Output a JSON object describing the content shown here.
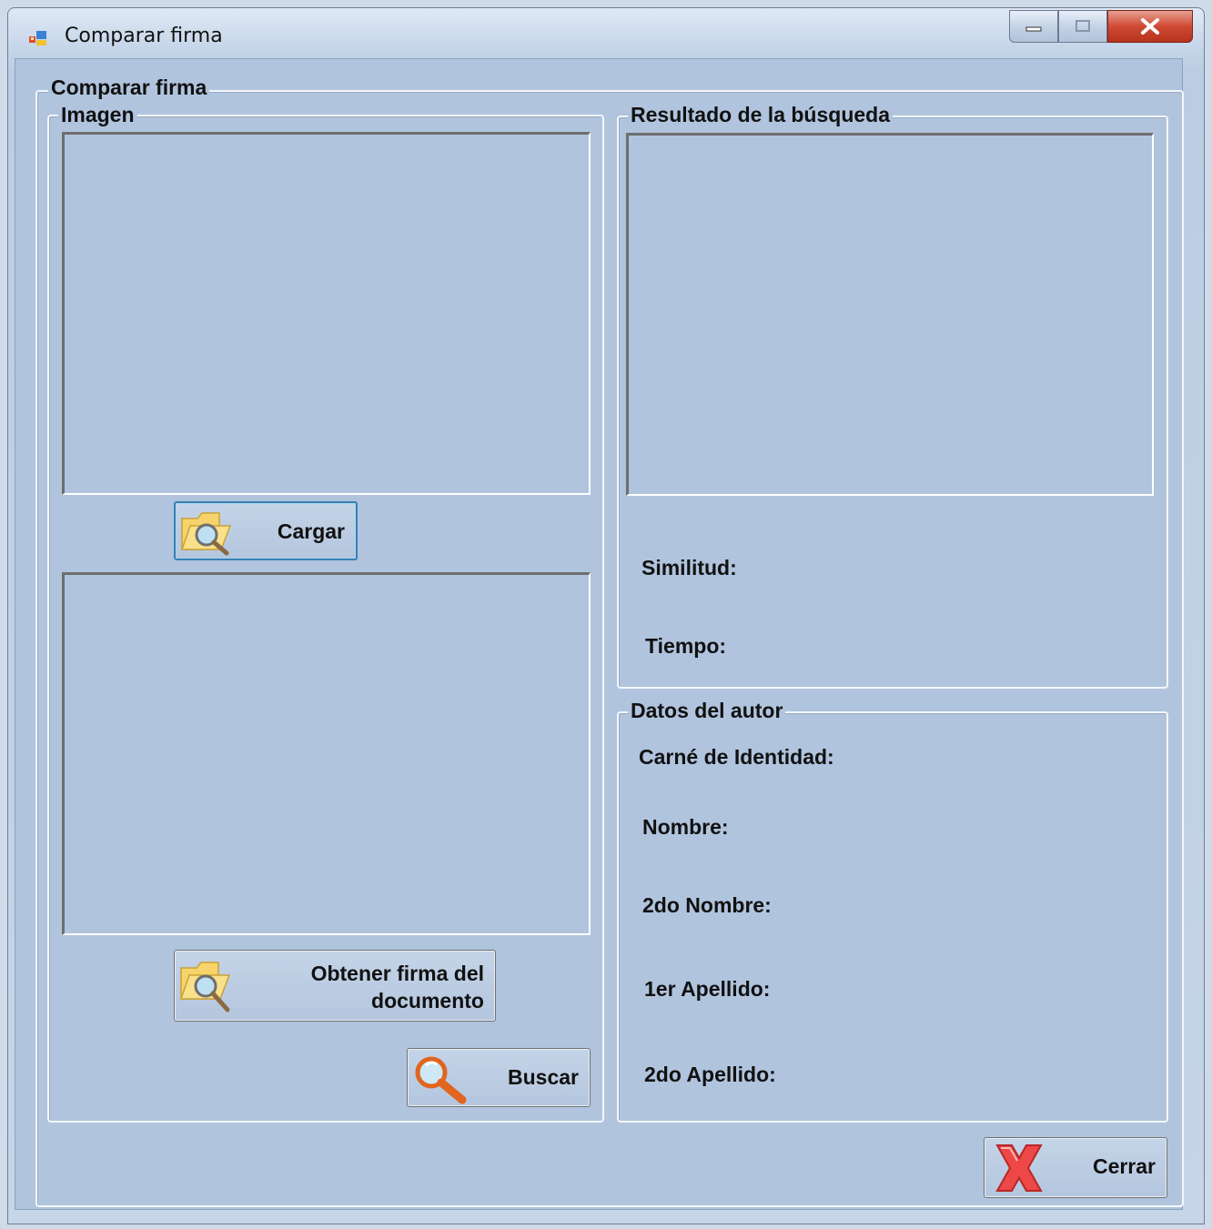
{
  "window": {
    "title": "Comparar firma",
    "caption_buttons": [
      "minimize",
      "maximize",
      "close"
    ]
  },
  "outer_group": {
    "label": "Comparar firma"
  },
  "image_group": {
    "label": "Imagen",
    "load_button": {
      "label": "Cargar",
      "icon": "folder-search-icon"
    },
    "extract_button": {
      "label_line1": "Obtener firma del",
      "label_line2": "documento",
      "icon": "folder-search-icon"
    },
    "search_button": {
      "label": "Buscar",
      "icon": "magnifier-icon"
    }
  },
  "result_group": {
    "label": "Resultado de la búsqueda",
    "similarity_label": "Similitud:",
    "time_label": "Tiempo:"
  },
  "author_group": {
    "label": "Datos del autor",
    "fields": [
      "Carné de Identidad:",
      "Nombre:",
      "2do Nombre:",
      "1er Apellido:",
      "2do Apellido:"
    ]
  },
  "close_button": {
    "label": "Cerrar",
    "icon": "red-x-icon"
  },
  "colors": {
    "form_bg": "#b0c4de",
    "close_red": "#e23a3a"
  }
}
